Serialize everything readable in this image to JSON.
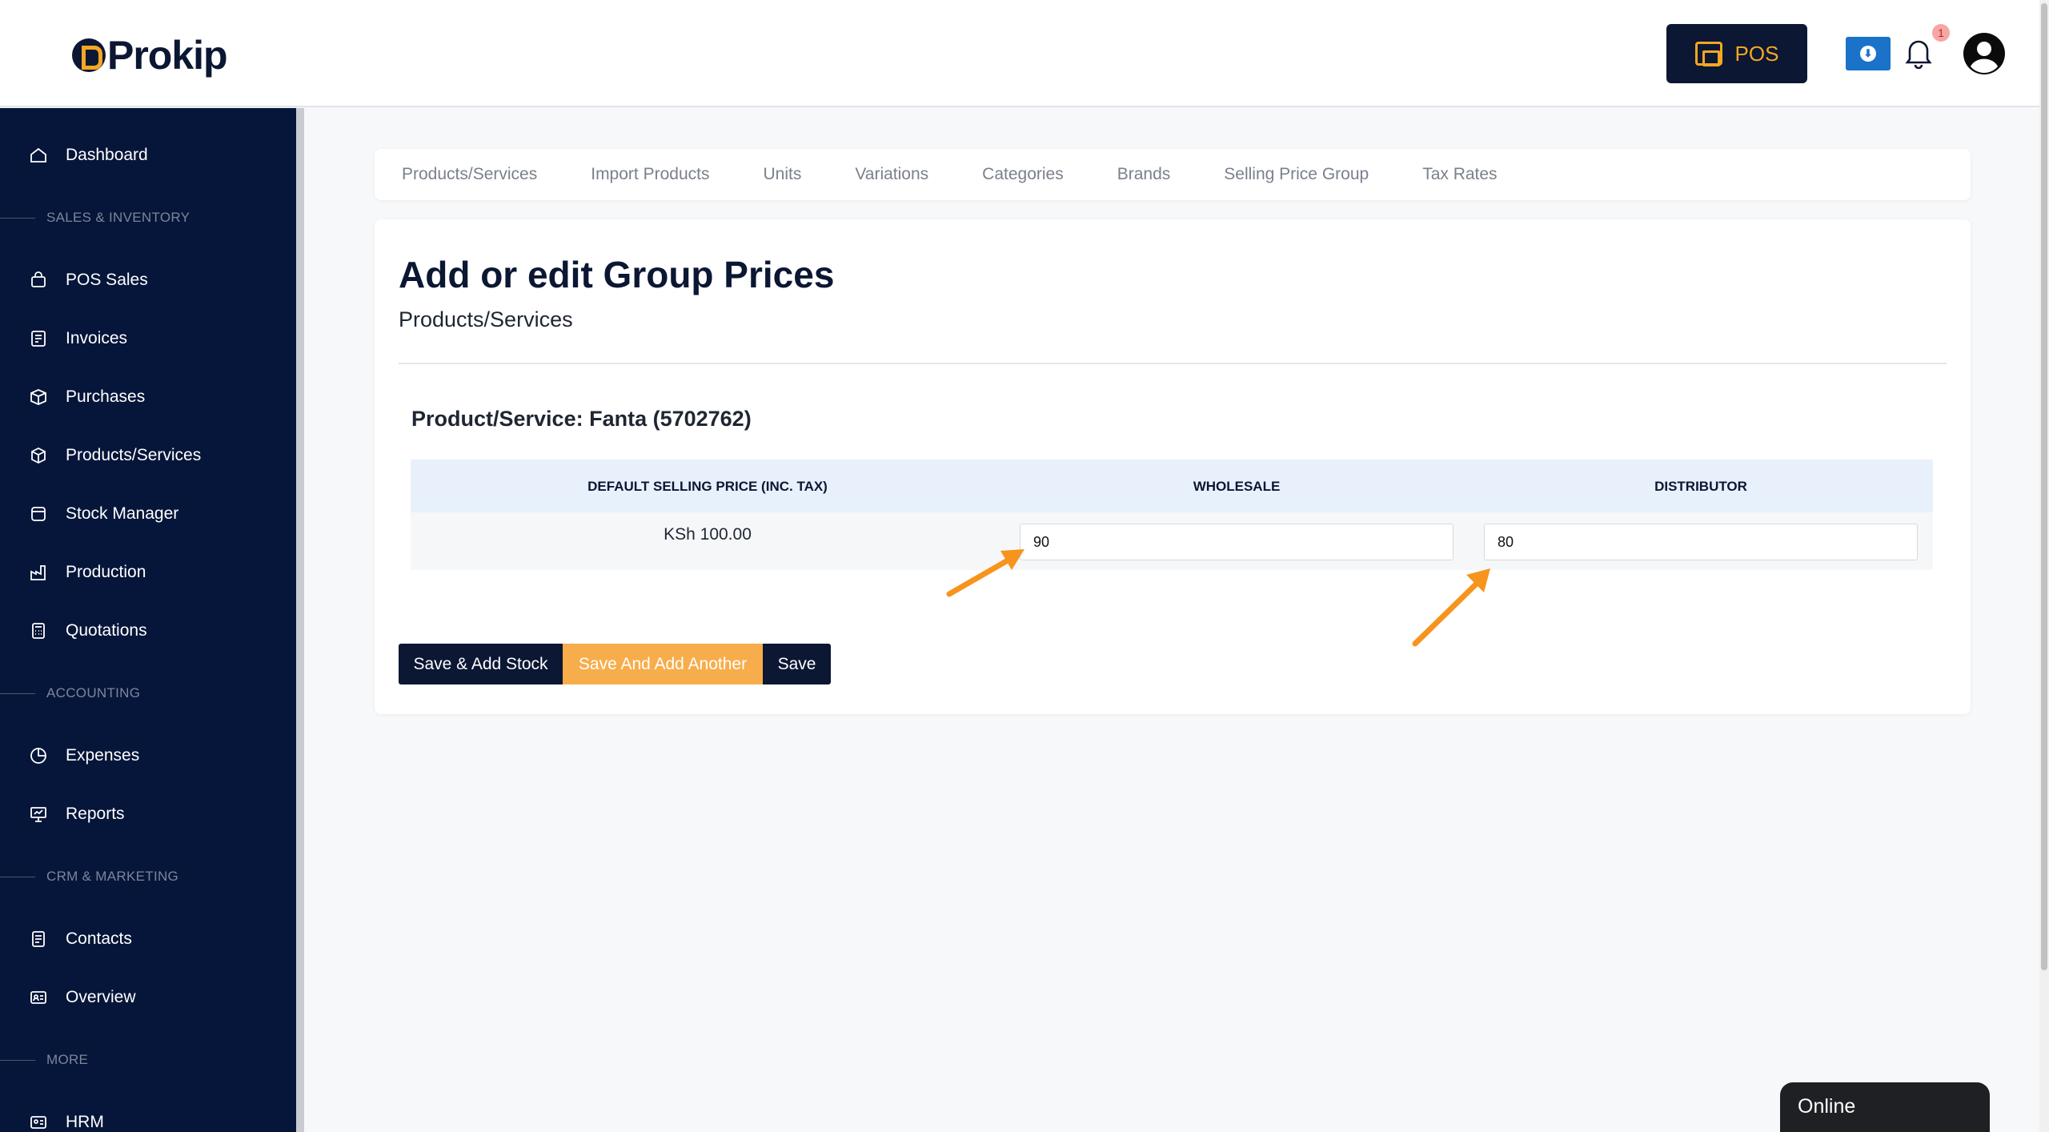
{
  "header": {
    "logo_text": "Prokip",
    "pos_label": "POS",
    "notification_count": "1"
  },
  "sidebar": {
    "items": [
      {
        "label": "Dashboard",
        "icon": "home-icon"
      },
      {
        "section": "SALES & INVENTORY"
      },
      {
        "label": "POS Sales",
        "icon": "bag-icon"
      },
      {
        "label": "Invoices",
        "icon": "invoice-icon"
      },
      {
        "label": "Purchases",
        "icon": "box-icon"
      },
      {
        "label": "Products/Services",
        "icon": "cube-icon"
      },
      {
        "label": "Stock Manager",
        "icon": "folder-icon"
      },
      {
        "label": "Production",
        "icon": "factory-icon"
      },
      {
        "label": "Quotations",
        "icon": "calculator-icon"
      },
      {
        "section": "ACCOUNTING"
      },
      {
        "label": "Expenses",
        "icon": "pie-icon"
      },
      {
        "label": "Reports",
        "icon": "presentation-icon"
      },
      {
        "section": "CRM & MARKETING"
      },
      {
        "label": "Contacts",
        "icon": "contacts-icon"
      },
      {
        "label": "Overview",
        "icon": "id-card-icon"
      },
      {
        "section": "MORE"
      },
      {
        "label": "HRM",
        "icon": "hrm-icon"
      }
    ]
  },
  "tabs": [
    "Products/Services",
    "Import Products",
    "Units",
    "Variations",
    "Categories",
    "Brands",
    "Selling Price Group",
    "Tax Rates"
  ],
  "page": {
    "title": "Add or edit Group Prices",
    "subtitle": "Products/Services",
    "product_label": "Product/Service: Fanta (5702762)"
  },
  "table": {
    "headers": [
      "DEFAULT SELLING PRICE (INC. TAX)",
      "WHOLESALE",
      "DISTRIBUTOR"
    ],
    "default_price": "KSh 100.00",
    "wholesale_value": "90",
    "distributor_value": "80"
  },
  "buttons": {
    "save_add_stock": "Save & Add Stock",
    "save_add_another": "Save And Add Another",
    "save": "Save"
  },
  "status": {
    "online": "Online"
  },
  "colors": {
    "navy": "#0b1733",
    "accent_orange": "#f5a623",
    "arrow_orange": "#f7941d",
    "download_blue": "#1a73c8"
  }
}
